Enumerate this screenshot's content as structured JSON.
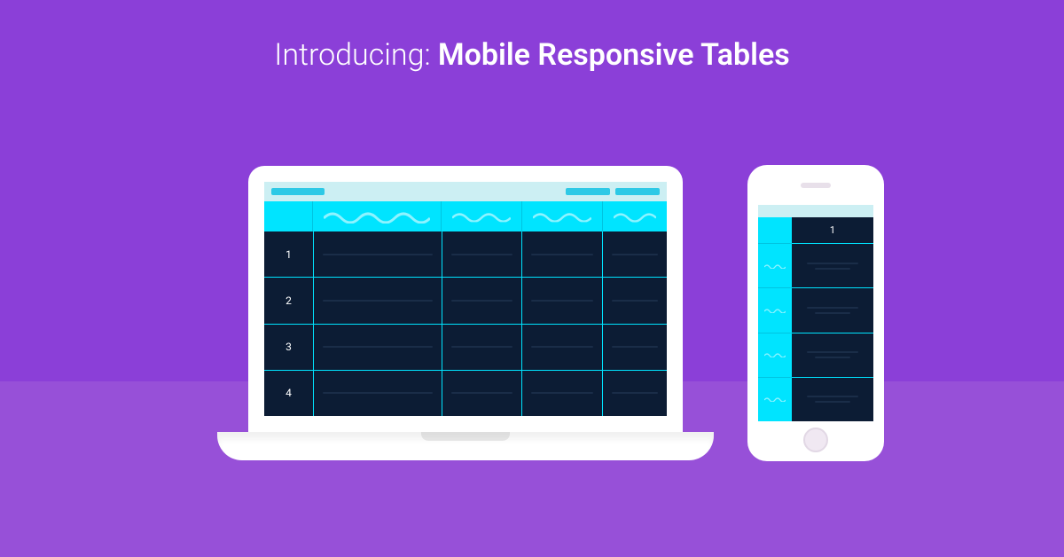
{
  "title": {
    "prefix": "Introducing: ",
    "main": "Mobile Responsive Tables"
  },
  "laptop": {
    "rows": [
      "1",
      "2",
      "3",
      "4"
    ],
    "columns": 4
  },
  "phone": {
    "header": "1",
    "sidebar_rows": 5,
    "data_rows": 4
  },
  "colors": {
    "bg_top": "#8b3fd8",
    "bg_bottom": "#9750d8",
    "accent": "#00e4ff",
    "accent_light": "#cceff3",
    "dark": "#0c1c34",
    "device": "#ffffff"
  }
}
